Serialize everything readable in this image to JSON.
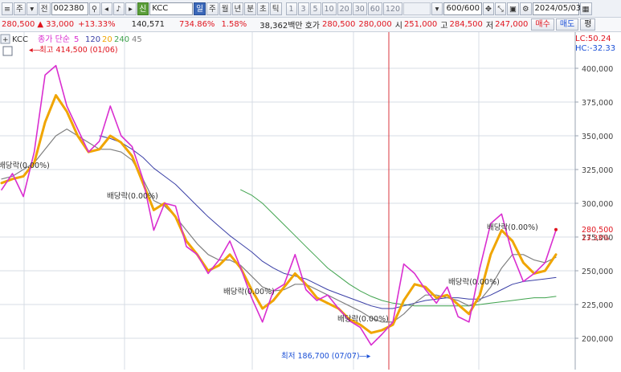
{
  "toolbar": {
    "menu_label": "주",
    "code_prefix": "전",
    "stock_code": "002380",
    "market_badge": "신",
    "stock_name": "KCC",
    "period_tabs": [
      "일",
      "주",
      "월",
      "년",
      "분",
      "초",
      "틱"
    ],
    "minute_options": [
      "1",
      "3",
      "5",
      "10",
      "20",
      "30",
      "60",
      "120"
    ],
    "count_value": "600/600",
    "date_value": "2024/05/03"
  },
  "quote": {
    "price": "280,500",
    "change_arrow": "▲",
    "change": "33,000",
    "change_pct": "+13.33%",
    "volume": "140,571",
    "volume_ratio": "734.86%",
    "turnover_rate": "1.58%",
    "amount": "38,362백만",
    "ask_label": "호가",
    "bid1": "280,500",
    "bid2": "280,000",
    "open_label": "시",
    "open": "251,000",
    "high_label": "고",
    "high": "284,500",
    "low_label": "저",
    "low": "247,000",
    "buy_label": "매수",
    "sell_label": "매도",
    "avg_label": "평"
  },
  "legend": {
    "name": "KCC",
    "series_text": "종가 단순",
    "ma": [
      "5",
      "120",
      "20",
      "240",
      "45"
    ]
  },
  "annotations": {
    "max_label": "최고 414,500 (01/06)",
    "min_label": "최저 186,700 (07/07)",
    "dividend_label": "배당락(0.00%)",
    "lc": "LC:50.24",
    "hc": "HC:-32.33",
    "price_tag": "280,500",
    "price_tag_pct": "13.33%"
  },
  "colors": {
    "up": "#e0141e",
    "down": "#1a4fd6",
    "ma5": "#d92ed0",
    "ma20": "#f0a500",
    "ma45": "#7f7f7f",
    "ma120": "#3a3fa6",
    "ma240": "#3fa34d",
    "cursor_line": "#d8343c"
  },
  "chart_data": {
    "type": "line",
    "title": "",
    "ylim": [
      180000,
      420000
    ],
    "y_ticks": [
      400000,
      375000,
      350000,
      325000,
      300000,
      275000,
      250000,
      225000,
      200000
    ],
    "y_tick_labels": [
      "400,000",
      "375,000",
      "350,000",
      "325,000",
      "300,000",
      "275,000",
      "250,000",
      "225,000",
      "200,000"
    ],
    "series": [
      {
        "name": "5",
        "values": [
          310000,
          322000,
          305000,
          338000,
          395000,
          402000,
          372000,
          355000,
          338000,
          346000,
          372000,
          350000,
          342000,
          318000,
          280000,
          300000,
          298000,
          268000,
          262000,
          248000,
          258000,
          272000,
          252000,
          230000,
          212000,
          235000,
          240000,
          262000,
          236000,
          228000,
          232000,
          222000,
          213000,
          208000,
          195000,
          203000,
          212000,
          255000,
          248000,
          236000,
          226000,
          238000,
          216000,
          212000,
          252000,
          285000,
          292000,
          262000,
          242000,
          248000,
          256000,
          280000
        ]
      },
      {
        "name": "20",
        "values": [
          315000,
          318000,
          320000,
          330000,
          360000,
          380000,
          368000,
          350000,
          338000,
          340000,
          350000,
          345000,
          335000,
          315000,
          295000,
          300000,
          290000,
          272000,
          262000,
          250000,
          254000,
          262000,
          252000,
          236000,
          222000,
          228000,
          238000,
          248000,
          240000,
          230000,
          226000,
          222000,
          214000,
          210000,
          204000,
          206000,
          210000,
          228000,
          240000,
          238000,
          230000,
          232000,
          225000,
          218000,
          232000,
          262000,
          280000,
          272000,
          256000,
          248000,
          250000,
          262000
        ]
      },
      {
        "name": "45",
        "values": [
          318000,
          320000,
          325000,
          330000,
          340000,
          350000,
          355000,
          350000,
          345000,
          340000,
          340000,
          338000,
          332000,
          318000,
          302000,
          298000,
          290000,
          280000,
          270000,
          262000,
          258000,
          258000,
          254000,
          246000,
          238000,
          235000,
          236000,
          240000,
          240000,
          236000,
          232000,
          228000,
          224000,
          220000,
          215000,
          212000,
          212000,
          218000,
          226000,
          232000,
          232000,
          230000,
          228000,
          224000,
          228000,
          238000,
          252000,
          262000,
          262000,
          258000,
          256000,
          260000
        ]
      },
      {
        "name": "120",
        "values": [
          null,
          null,
          null,
          null,
          null,
          null,
          null,
          null,
          null,
          350000,
          348000,
          345000,
          340000,
          334000,
          326000,
          320000,
          314000,
          306000,
          298000,
          290000,
          283000,
          276000,
          270000,
          264000,
          257000,
          252000,
          248000,
          246000,
          244000,
          240000,
          236000,
          233000,
          230000,
          227000,
          224000,
          222000,
          222000,
          224000,
          226000,
          228000,
          229000,
          230000,
          230000,
          229000,
          229000,
          232000,
          236000,
          240000,
          242000,
          243000,
          244000,
          245000
        ]
      },
      {
        "name": "240",
        "values": [
          null,
          null,
          null,
          null,
          null,
          null,
          null,
          null,
          null,
          null,
          null,
          null,
          null,
          null,
          null,
          null,
          null,
          null,
          null,
          null,
          null,
          null,
          310000,
          306000,
          300000,
          292000,
          284000,
          276000,
          268000,
          260000,
          252000,
          246000,
          240000,
          235000,
          231000,
          228000,
          226000,
          225000,
          224000,
          224000,
          224000,
          224000,
          224000,
          224000,
          225000,
          226000,
          227000,
          228000,
          229000,
          230000,
          230000,
          231000
        ]
      }
    ],
    "max_point": {
      "value": 414500,
      "date": "01/06"
    },
    "min_point": {
      "value": 186700,
      "date": "07/07"
    },
    "last_close": 280500,
    "legend_position": "top-left"
  }
}
